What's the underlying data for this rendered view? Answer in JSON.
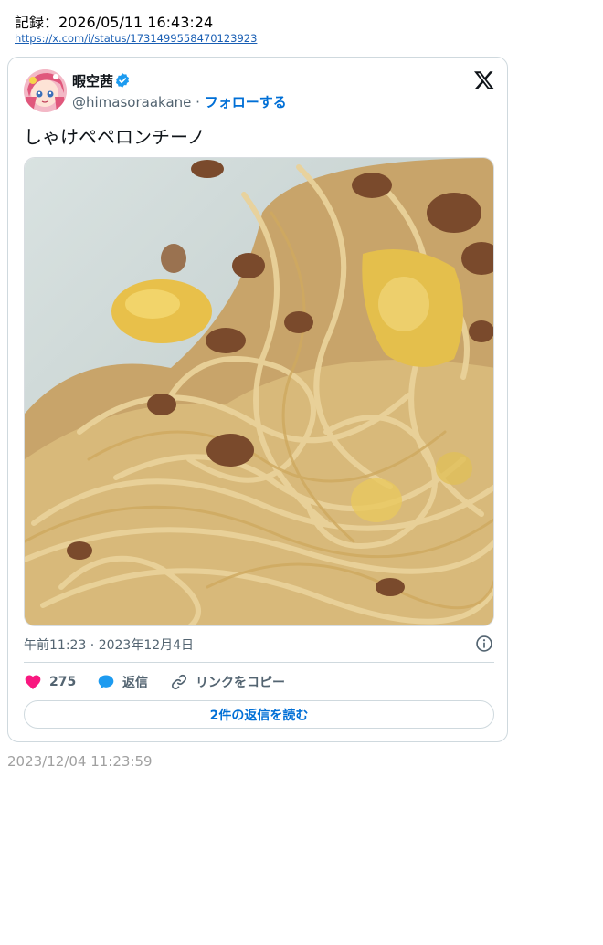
{
  "record": {
    "label": "記録：2026/05/11 16:43:24",
    "url": "https://x.com/i/status/1731499558470123923"
  },
  "tweet": {
    "author_name": "暇空茜",
    "handle": "@himasoraakane",
    "separator": " · ",
    "follow_label": "フォローする",
    "text": "しゃけペペロンチーノ",
    "photo_description": "spaghetti-peperoncino-with-salmon",
    "timestamp": "午前11:23 · 2023年12月4日",
    "likes_count": "275",
    "reply_label": "返信",
    "copy_link_label": "リンクをコピー",
    "read_replies_label": "2件の返信を読む"
  },
  "saved_time": "2023/12/04 11:23:59",
  "colors": {
    "accent_blue": "#1d9bf0",
    "link_blue": "#006fd6",
    "like_pink": "#f91880",
    "muted_text": "#536471",
    "border": "#cfd9de"
  },
  "icons": {
    "verified": "verified-badge-icon",
    "platform": "x-logo-icon",
    "info": "info-icon",
    "like": "heart-icon",
    "reply": "speech-bubble-icon",
    "copy": "link-icon"
  }
}
